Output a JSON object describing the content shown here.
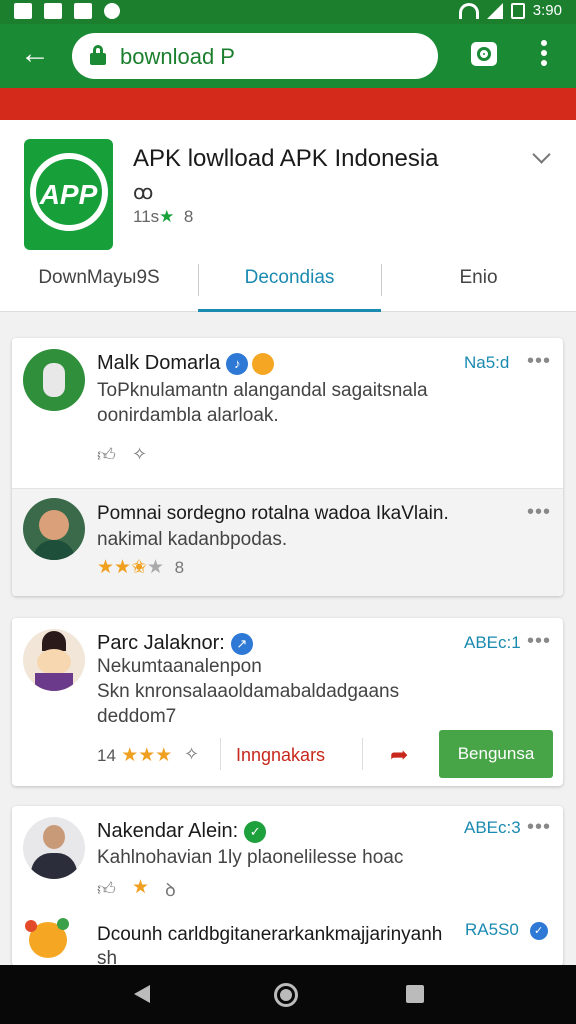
{
  "status": {
    "time": "3:90"
  },
  "browser": {
    "url": "bownload P"
  },
  "app": {
    "title": "APK lowlload APK Indonesia",
    "logo_text": "APP",
    "sub1": "ꝏ",
    "sub2_prefix": "11s",
    "sub2_star": "★",
    "sub2_suffix": "8"
  },
  "tabs": [
    "DownMaуы9S",
    "Decondias",
    "Enio"
  ],
  "reviews": [
    {
      "name": "Malk Domarla",
      "verified_glyph": "♪",
      "time": "Na5:d",
      "text_l1": "ToPknulamantn alangandal sagaitsnala",
      "text_l2": "oonirdambla alarloak."
    },
    {
      "name": "Pomnai sordegno rotalna wadoa IkaVlain.",
      "text_l1": "nakimal kadanbpodas.",
      "rating_suffix": "8"
    },
    {
      "name": "Parc Jalaknor:",
      "verified_glyph": "↗",
      "time": "ABEc:1",
      "text_l1": "Nekumtaanalenpon",
      "text_l2": "Skn knronsalaaoldamabaldadgaans",
      "text_l3": "deddom7",
      "count": "14",
      "link": "Inngnakars",
      "button": "Bengunsa"
    },
    {
      "name": "Nakendar Alein:",
      "verified_glyph": "✓",
      "time": "ABEc:3",
      "text_l1": "Kahlnohavian 1ly plaonelilesse hoac",
      "act3": "ꝺ"
    },
    {
      "name": "Dcounh carldbgitanerarkankmajjarinyanh",
      "time": "RA5S0",
      "text_l1": "sh"
    }
  ],
  "colors": {
    "primary": "#1b8a35",
    "accent": "#1a8ab0",
    "red": "#d42a1c",
    "star": "#f0a020"
  }
}
